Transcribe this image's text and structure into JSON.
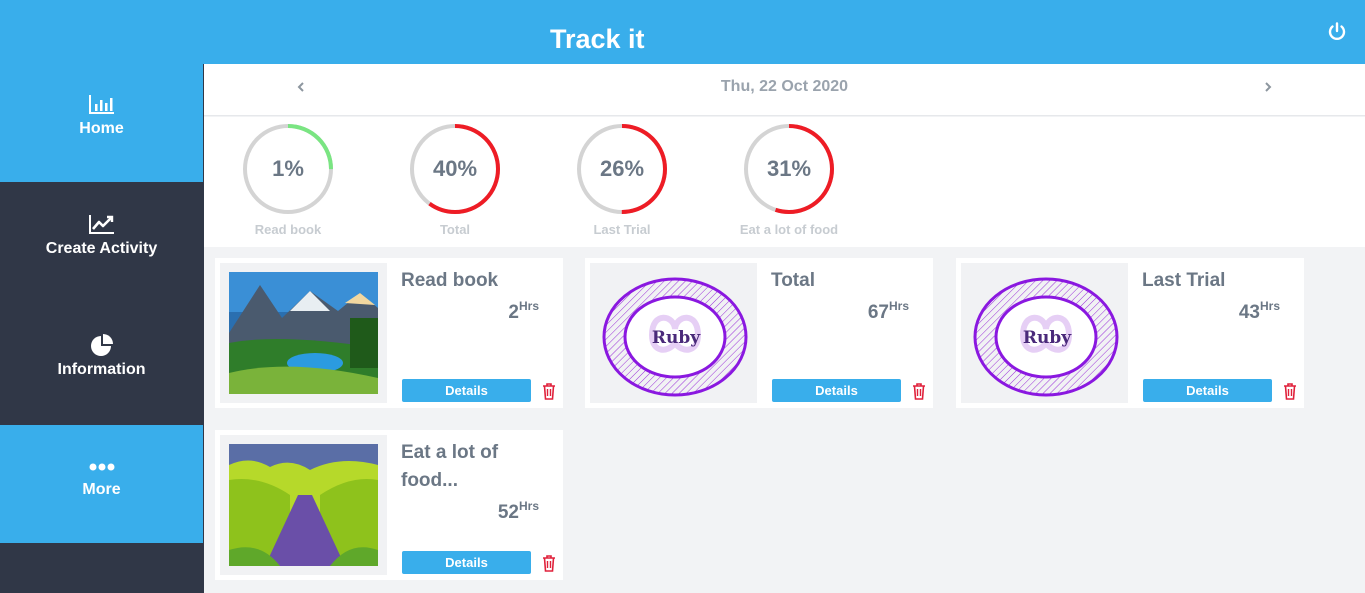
{
  "header": {
    "title": "Track it",
    "power_icon": "power-icon"
  },
  "sidebar": {
    "items": [
      {
        "label": "Home",
        "icon": "bar-chart-icon",
        "active": true
      },
      {
        "label": "Create Activity",
        "icon": "line-chart-icon",
        "active": false
      },
      {
        "label": "Information",
        "icon": "pie-chart-icon",
        "active": false
      },
      {
        "label": "More",
        "icon": "more-dots-icon",
        "active": true
      }
    ]
  },
  "datebar": {
    "date": "Thu, 22 Oct 2020",
    "prev_icon": "chevron-left-icon",
    "next_icon": "chevron-right-icon"
  },
  "progress": [
    {
      "value_text": "1%",
      "fraction": 0.25,
      "color": "#7ae582",
      "label": "Read book"
    },
    {
      "value_text": "40%",
      "fraction": 0.6,
      "color": "#ee1c25",
      "label": "Total"
    },
    {
      "value_text": "26%",
      "fraction": 0.5,
      "color": "#ee1c25",
      "label": "Last Trial"
    },
    {
      "value_text": "31%",
      "fraction": 0.55,
      "color": "#ee1c25",
      "label": "Eat a lot of food"
    }
  ],
  "activities": [
    {
      "title": "Read book",
      "hours": "2",
      "unit": "Hrs",
      "image": "mountain-lake-photo",
      "button": "Details",
      "delete_icon": "trash-icon"
    },
    {
      "title": "Total",
      "hours": "67",
      "unit": "Hrs",
      "image": "ruby-logo",
      "logo_text": "Ruby",
      "button": "Details",
      "delete_icon": "trash-icon"
    },
    {
      "title": "Last Trial",
      "hours": "43",
      "unit": "Hrs",
      "image": "ruby-logo",
      "logo_text": "Ruby",
      "button": "Details",
      "delete_icon": "trash-icon"
    },
    {
      "title": "Eat a lot of food...",
      "hours": "52",
      "unit": "Hrs",
      "image": "tree-road-photo",
      "button": "Details",
      "delete_icon": "trash-icon"
    }
  ],
  "colors": {
    "accent": "#39aeeb",
    "sidebar": "#303747",
    "delete": "#e0213b"
  }
}
